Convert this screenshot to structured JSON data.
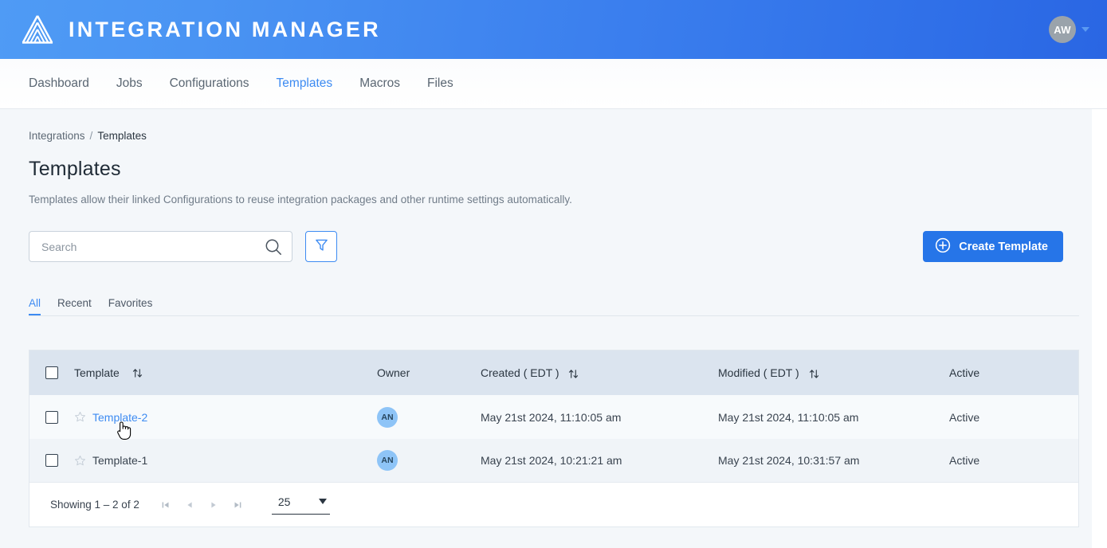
{
  "app": {
    "title": "INTEGRATION MANAGER",
    "logo_icon": "mountain-layers-logo-icon",
    "user_initials": "AW",
    "user_caret_icon": "chevron-down-icon"
  },
  "nav": {
    "items": [
      {
        "label": "Dashboard",
        "active": false
      },
      {
        "label": "Jobs",
        "active": false
      },
      {
        "label": "Configurations",
        "active": false
      },
      {
        "label": "Templates",
        "active": true
      },
      {
        "label": "Macros",
        "active": false
      },
      {
        "label": "Files",
        "active": false
      }
    ]
  },
  "breadcrumb": {
    "parent": "Integrations",
    "separator": "/",
    "current": "Templates"
  },
  "header": {
    "title": "Templates",
    "description": "Templates allow their linked Configurations to reuse integration packages and other runtime settings automatically."
  },
  "search": {
    "value": "",
    "placeholder": "Search",
    "search_icon": "search-icon",
    "filter_icon": "funnel-filter-icon"
  },
  "create_button": {
    "label": "Create Template",
    "icon": "plus-circle-icon"
  },
  "subtabs": [
    {
      "label": "All",
      "active": true
    },
    {
      "label": "Recent",
      "active": false
    },
    {
      "label": "Favorites",
      "active": false
    }
  ],
  "table": {
    "columns": [
      {
        "key": "select",
        "label": "",
        "sortable": false
      },
      {
        "key": "template",
        "label": "Template",
        "sortable": true
      },
      {
        "key": "owner",
        "label": "Owner",
        "sortable": false
      },
      {
        "key": "created",
        "label": "Created ( EDT )",
        "sortable": true
      },
      {
        "key": "modified",
        "label": "Modified ( EDT )",
        "sortable": true
      },
      {
        "key": "active",
        "label": "Active",
        "sortable": false
      }
    ],
    "rows": [
      {
        "template": "Template-2",
        "owner": "AN",
        "created": "May 21st 2024, 11:10:05 am",
        "modified": "May 21st 2024, 11:10:05 am",
        "active": "Active",
        "hovered": true,
        "favorited": false
      },
      {
        "template": "Template-1",
        "owner": "AN",
        "created": "May 21st 2024, 10:21:21 am",
        "modified": "May 21st 2024, 10:31:57 am",
        "active": "Active",
        "hovered": false,
        "favorited": false
      }
    ]
  },
  "pagination": {
    "showing": "Showing 1 – 2 of 2",
    "first_icon": "first-page-icon",
    "prev_icon": "previous-page-icon",
    "next_icon": "next-page-icon",
    "last_icon": "last-page-icon",
    "page_size": "25",
    "page_size_caret": "chevron-down-icon"
  },
  "colors": {
    "accent": "#3d8bf2",
    "brand_button": "#2675e8",
    "page_bg": "#f4f7fa",
    "table_header_bg": "#dbe4ef"
  }
}
